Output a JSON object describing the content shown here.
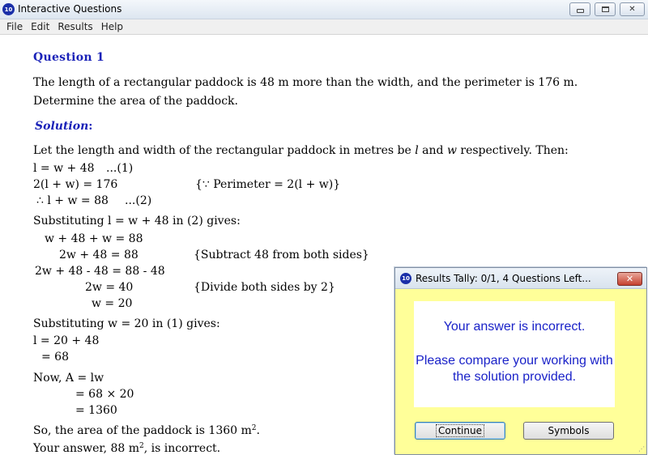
{
  "window": {
    "title": "Interactive Questions",
    "icon_label": "10"
  },
  "menu": [
    "File",
    "Edit",
    "Results",
    "Help"
  ],
  "question": {
    "title": "Question 1",
    "text_line1": "The length of a rectangular paddock is 48 m more than the width, and the perimeter is 176 m.",
    "text_line2": "Determine the area of the paddock."
  },
  "solution": {
    "title": "Solution",
    "colon": ":",
    "intro_a": "Let the length and width of the rectangular paddock in metres be ",
    "intro_l": "l",
    "intro_b": " and ",
    "intro_w": "w",
    "intro_c": " respectively.  Then:",
    "eq1": "l = w + 48",
    "eq1_tag": "...(1)",
    "eq2": "2(l + w) = 176",
    "eq2_note": "{∵ Perimeter = 2(l + w)}",
    "eq3": "∴ l + w = 88",
    "eq3_tag": "...(2)",
    "subst1": "Substituting l = w + 48 in (2) gives:",
    "s1": "w + 48 + w = 88",
    "s2": "2w + 48 = 88",
    "s2_note": "{Subtract 48 from both sides}",
    "s3": "2w + 48 - 48 = 88 - 48",
    "s4": "2w = 40",
    "s4_note": "{Divide both sides by 2}",
    "s5": "w = 20",
    "subst2": "Substituting w = 20 in (1) gives:",
    "r1": "l = 20 + 48",
    "r2": "= 68",
    "area1": "Now, A = lw",
    "area2": "= 68 × 20",
    "area3": "= 1360",
    "conclusion_a": "So, the area of the paddock is 1360 m",
    "conclusion_sup": "2",
    "conclusion_b": ".",
    "answer_a": "Your answer, 88 m",
    "answer_sup": "2",
    "answer_b": ", is incorrect."
  },
  "dialog": {
    "title": "Results Tally: 0/1, 4 Questions Left...",
    "close_label": "✕",
    "message1": "Your answer is incorrect.",
    "message2": "Please compare your working with the solution provided.",
    "continue_label": "Continue",
    "symbols_label": "Symbols",
    "background_color": "#ffff99",
    "message_color": "#1a22c8"
  },
  "colors": {
    "heading": "#1a22b8"
  }
}
